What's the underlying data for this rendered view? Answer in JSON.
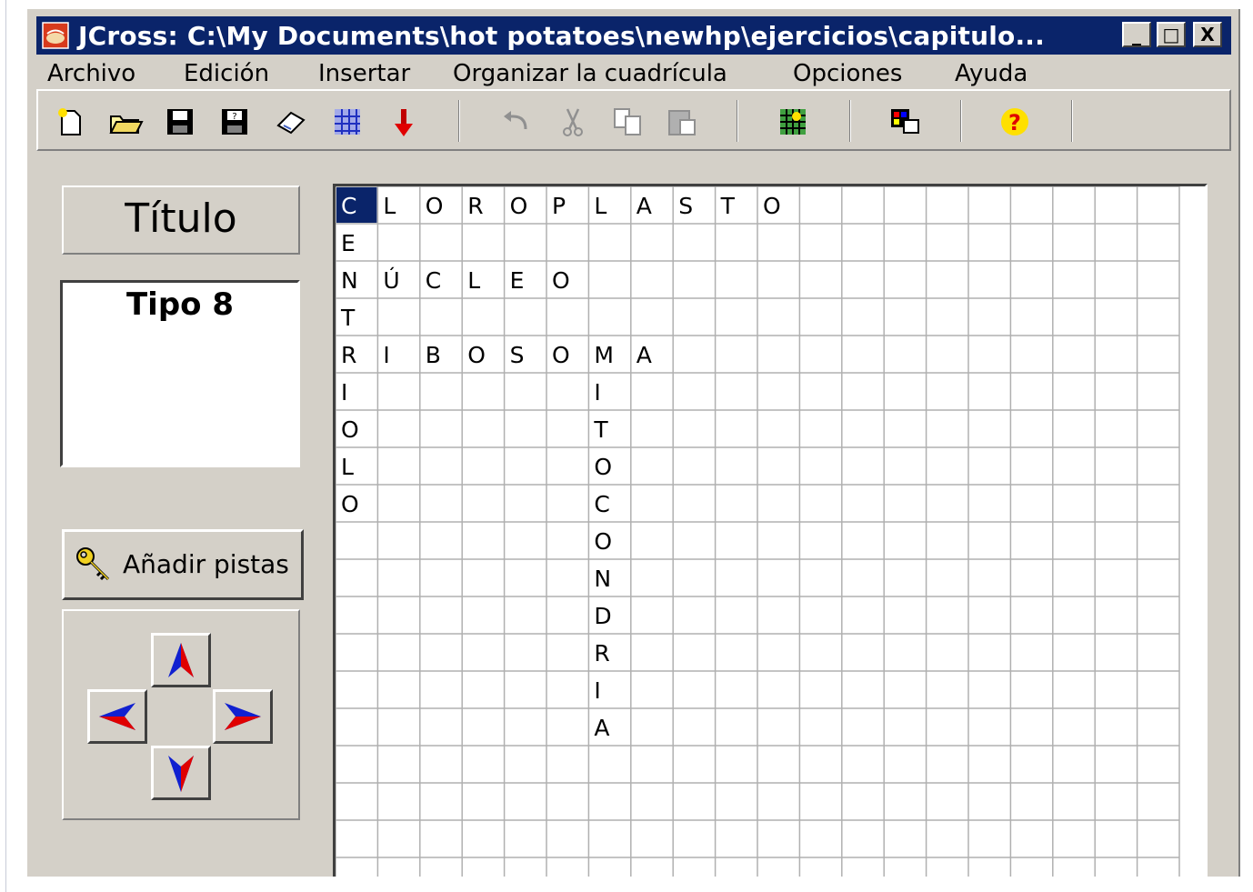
{
  "window": {
    "title": "JCross: C:\\My Documents\\hot potatoes\\newhp\\ejercicios\\capitulo...",
    "controls": [
      "_",
      "□",
      "X"
    ]
  },
  "menu": [
    "Archivo",
    "Edición",
    "Insertar",
    "Organizar la cuadrícula",
    "Opciones",
    "Ayuda"
  ],
  "toolbar": {
    "icons": [
      "new-file-icon",
      "open-folder-icon",
      "save-icon",
      "save-as-icon",
      "eraser-icon",
      "web-export-icon",
      "arrow-down-icon",
      "undo-icon",
      "cut-icon",
      "copy-icon",
      "paste-icon",
      "grid-icon",
      "palette-icon",
      "help-icon"
    ]
  },
  "sidebar": {
    "title_button": "Título",
    "puzzle_title": "Tipo 8",
    "add_clues_button": "Añadir pistas",
    "arrow_buttons": [
      "up",
      "left",
      "right",
      "down"
    ]
  },
  "grid": {
    "selected_cell": [
      0,
      0
    ],
    "cells": [
      {
        "r": 0,
        "c": 0,
        "t": "C"
      },
      {
        "r": 0,
        "c": 1,
        "t": "L"
      },
      {
        "r": 0,
        "c": 2,
        "t": "O"
      },
      {
        "r": 0,
        "c": 3,
        "t": "R"
      },
      {
        "r": 0,
        "c": 4,
        "t": "O"
      },
      {
        "r": 0,
        "c": 5,
        "t": "P"
      },
      {
        "r": 0,
        "c": 6,
        "t": "L"
      },
      {
        "r": 0,
        "c": 7,
        "t": "A"
      },
      {
        "r": 0,
        "c": 8,
        "t": "S"
      },
      {
        "r": 0,
        "c": 9,
        "t": "T"
      },
      {
        "r": 0,
        "c": 10,
        "t": "O"
      },
      {
        "r": 1,
        "c": 0,
        "t": "E"
      },
      {
        "r": 2,
        "c": 0,
        "t": "N"
      },
      {
        "r": 2,
        "c": 1,
        "t": "Ú"
      },
      {
        "r": 2,
        "c": 2,
        "t": "C"
      },
      {
        "r": 2,
        "c": 3,
        "t": "L"
      },
      {
        "r": 2,
        "c": 4,
        "t": "E"
      },
      {
        "r": 2,
        "c": 5,
        "t": "O"
      },
      {
        "r": 3,
        "c": 0,
        "t": "T"
      },
      {
        "r": 4,
        "c": 0,
        "t": "R"
      },
      {
        "r": 4,
        "c": 1,
        "t": "I"
      },
      {
        "r": 4,
        "c": 2,
        "t": "B"
      },
      {
        "r": 4,
        "c": 3,
        "t": "O"
      },
      {
        "r": 4,
        "c": 4,
        "t": "S"
      },
      {
        "r": 4,
        "c": 5,
        "t": "O"
      },
      {
        "r": 4,
        "c": 6,
        "t": "M"
      },
      {
        "r": 4,
        "c": 7,
        "t": "A"
      },
      {
        "r": 5,
        "c": 0,
        "t": "I"
      },
      {
        "r": 5,
        "c": 6,
        "t": "I"
      },
      {
        "r": 6,
        "c": 0,
        "t": "O"
      },
      {
        "r": 6,
        "c": 6,
        "t": "T"
      },
      {
        "r": 7,
        "c": 0,
        "t": "L"
      },
      {
        "r": 7,
        "c": 6,
        "t": "O"
      },
      {
        "r": 8,
        "c": 0,
        "t": "O"
      },
      {
        "r": 8,
        "c": 6,
        "t": "C"
      },
      {
        "r": 9,
        "c": 6,
        "t": "O"
      },
      {
        "r": 10,
        "c": 6,
        "t": "N"
      },
      {
        "r": 11,
        "c": 6,
        "t": "D"
      },
      {
        "r": 12,
        "c": 6,
        "t": "R"
      },
      {
        "r": 13,
        "c": 6,
        "t": "I"
      },
      {
        "r": 14,
        "c": 6,
        "t": "A"
      }
    ]
  }
}
